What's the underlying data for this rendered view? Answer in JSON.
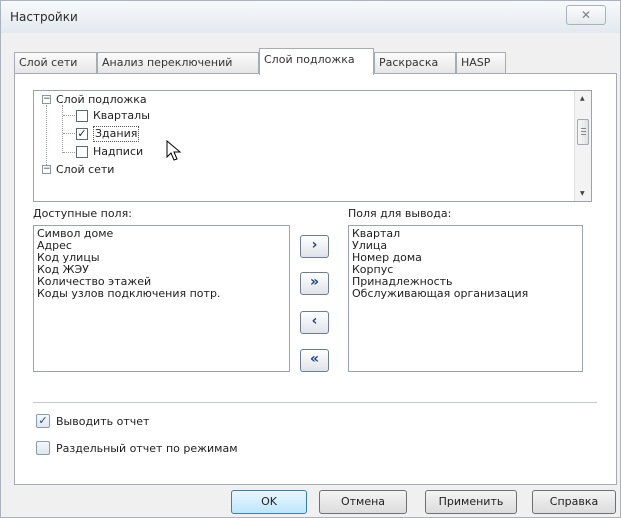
{
  "window": {
    "title": "Настройки",
    "close_glyph": "✕"
  },
  "tabs": [
    {
      "label": "Слой сети"
    },
    {
      "label": "Анализ переключений"
    },
    {
      "label": "Слой подложка"
    },
    {
      "label": "Раскраска"
    },
    {
      "label": "HASP"
    }
  ],
  "active_tab": "Слой подложка",
  "tree": {
    "root1": {
      "label": "Слой подложка",
      "expander": "−"
    },
    "children": [
      {
        "label": "Кварталы",
        "mark": ""
      },
      {
        "label": "Здания",
        "mark": "✓"
      },
      {
        "label": "Надписи",
        "mark": ""
      }
    ],
    "root2": {
      "label": "Слой сети",
      "expander": "−"
    }
  },
  "available": {
    "label": "Доступные поля:",
    "items": [
      "Символ доме",
      "Адрес",
      "Код улицы",
      "Код ЖЭУ",
      "Количество этажей",
      "Коды узлов подключения потр."
    ]
  },
  "output": {
    "label": "Поля для вывода:",
    "items": [
      "Квартал",
      "Улица",
      "Номер дома",
      "Корпус",
      "Принадлежность",
      "Обслуживающая организация"
    ]
  },
  "move_buttons": {
    "add": "›",
    "add_all": "»",
    "remove": "‹",
    "remove_all": "«"
  },
  "options": [
    {
      "label": "Выводить отчет",
      "mark": "✓"
    },
    {
      "label": "Раздельный отчет по режимам",
      "mark": ""
    }
  ],
  "buttons": {
    "ok": "OK",
    "cancel": "Отмена",
    "apply": "Применить",
    "help": "Справка"
  }
}
